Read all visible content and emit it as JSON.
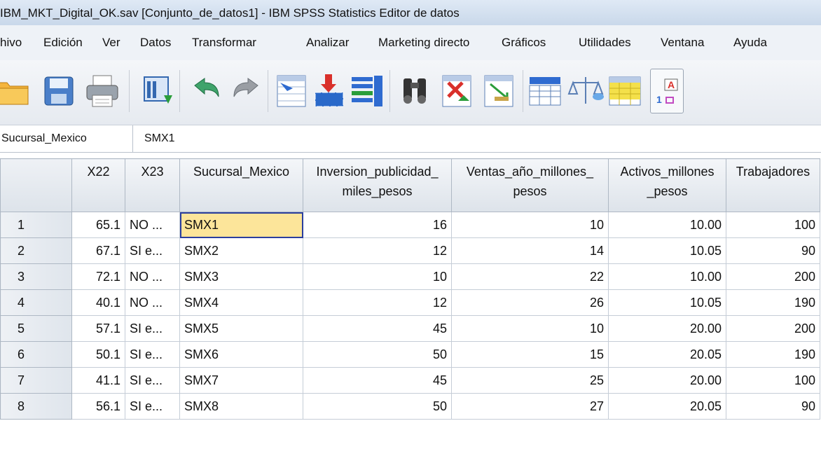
{
  "window": {
    "title": "IBM_MKT_Digital_OK.sav [Conjunto_de_datos1] - IBM SPSS Statistics Editor de datos"
  },
  "menu": [
    "hivo",
    "Edición",
    "Ver",
    "Datos",
    "Transformar",
    "Analizar",
    "Marketing directo",
    "Gráficos",
    "Utilidades",
    "Ventana",
    "Ayuda"
  ],
  "toolbar": {
    "icons": [
      "open-folder-icon",
      "save-icon",
      "print-icon",
      "recall-dialog-icon",
      "undo-icon",
      "redo-icon",
      "goto-case-icon",
      "goto-variable-icon",
      "variables-icon",
      "find-icon",
      "insert-cases-icon",
      "insert-variable-icon",
      "split-file-icon",
      "weight-cases-icon",
      "select-cases-icon",
      "value-labels-icon"
    ]
  },
  "cell_editor": {
    "name": "Sucursal_Mexico",
    "value": "SMX1"
  },
  "grid": {
    "columns": [
      {
        "label": "X22",
        "align": "num"
      },
      {
        "label": "X23",
        "align": "text"
      },
      {
        "label": "Sucursal_Mexico",
        "align": "text"
      },
      {
        "label": "Inversion_publicidad_ miles_pesos",
        "align": "num"
      },
      {
        "label": "Ventas_año_millones_ pesos",
        "align": "num"
      },
      {
        "label": "Activos_millones _pesos",
        "align": "num"
      },
      {
        "label": "Trabajadores",
        "align": "num"
      }
    ],
    "rows": [
      {
        "n": "1",
        "cells": [
          "65.1",
          "NO ...",
          "SMX1",
          "16",
          "10",
          "10.00",
          "100"
        ]
      },
      {
        "n": "2",
        "cells": [
          "67.1",
          "SI e...",
          "SMX2",
          "12",
          "14",
          "10.05",
          "90"
        ]
      },
      {
        "n": "3",
        "cells": [
          "72.1",
          "NO ...",
          "SMX3",
          "10",
          "22",
          "10.00",
          "200"
        ]
      },
      {
        "n": "4",
        "cells": [
          "40.1",
          "NO ...",
          "SMX4",
          "12",
          "26",
          "10.05",
          "190"
        ]
      },
      {
        "n": "5",
        "cells": [
          "57.1",
          "SI e...",
          "SMX5",
          "45",
          "10",
          "20.00",
          "200"
        ]
      },
      {
        "n": "6",
        "cells": [
          "50.1",
          "SI e...",
          "SMX6",
          "50",
          "15",
          "20.05",
          "190"
        ]
      },
      {
        "n": "7",
        "cells": [
          "41.1",
          "SI e...",
          "SMX7",
          "45",
          "25",
          "20.00",
          "100"
        ]
      },
      {
        "n": "8",
        "cells": [
          "56.1",
          "SI e...",
          "SMX8",
          "50",
          "27",
          "20.05",
          "90"
        ]
      }
    ],
    "selected": {
      "row": 0,
      "col": 2
    }
  }
}
